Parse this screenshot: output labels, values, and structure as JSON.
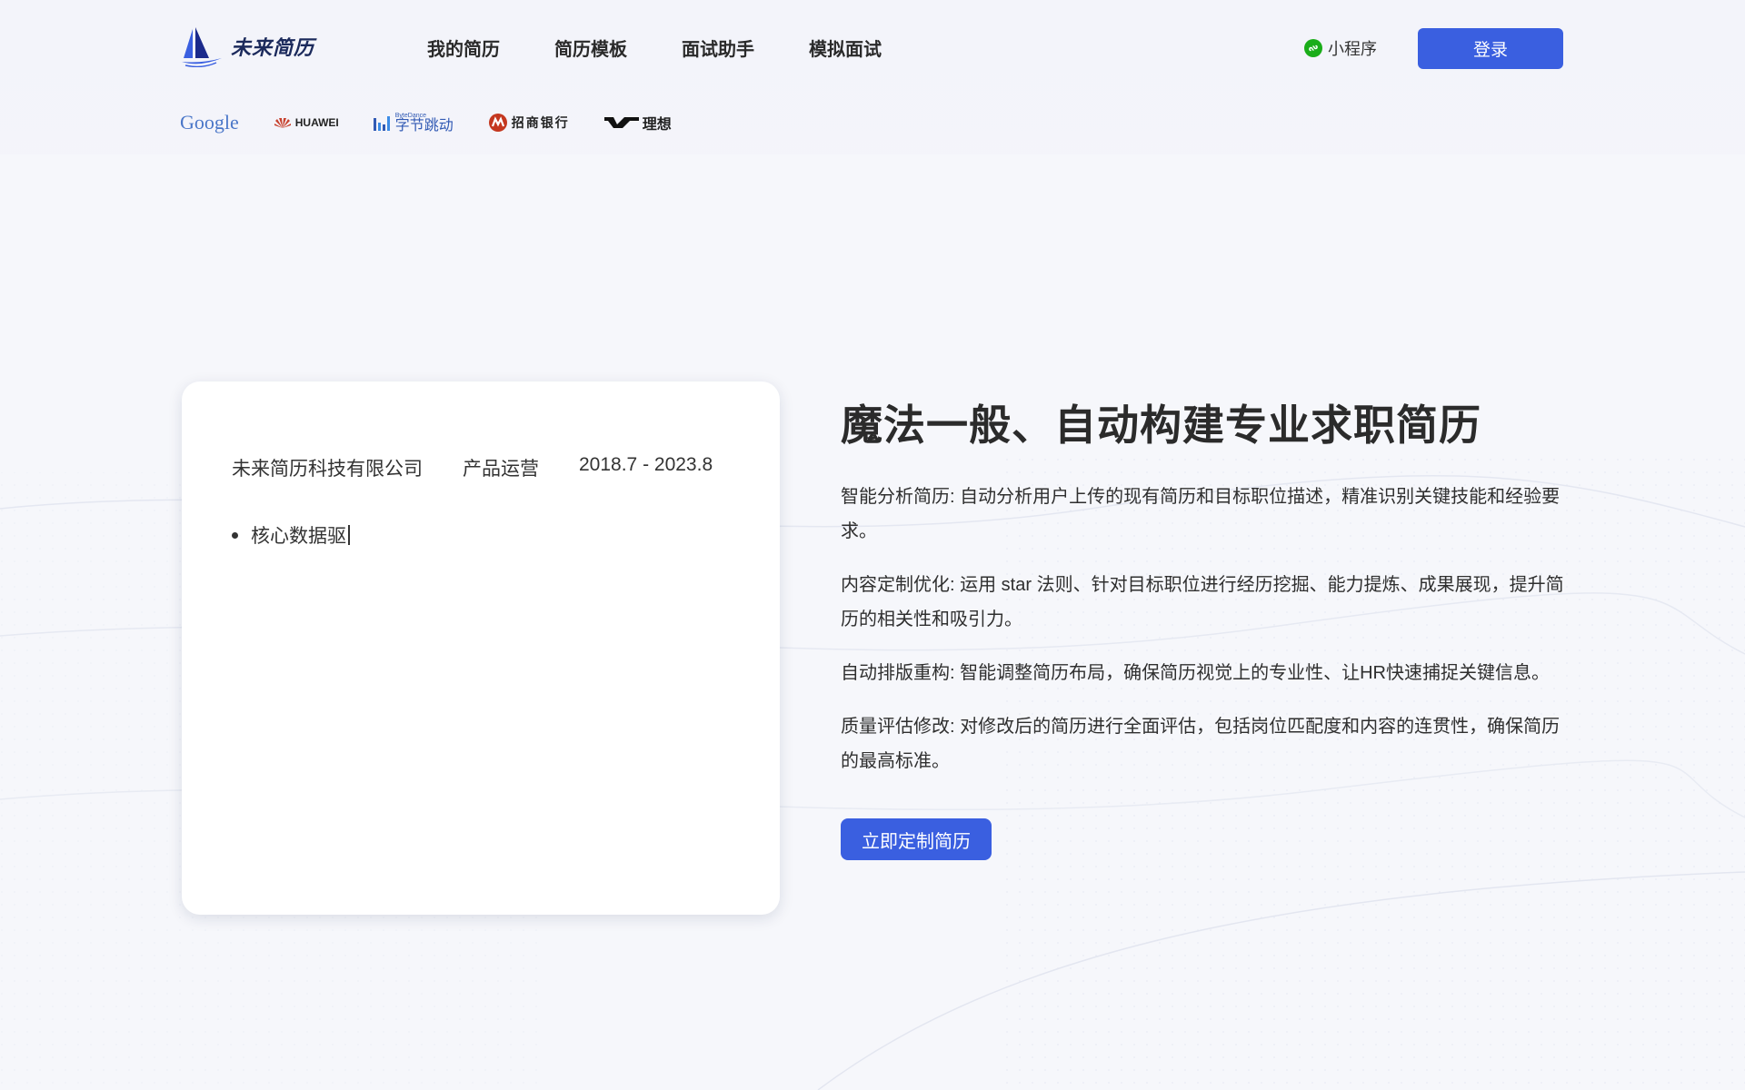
{
  "header": {
    "logo_text": "未来简历",
    "nav": [
      "我的简历",
      "简历模板",
      "面试助手",
      "模拟面试"
    ],
    "mini_program": "小程序",
    "login": "登录"
  },
  "partners": {
    "google": "Google",
    "huawei": "HUAWEI",
    "bytedance": "字节跳动",
    "bytedance_small": "ByteDance",
    "cmb": "招商银行",
    "lixiang": "理想"
  },
  "card": {
    "company": "未来简历科技有限公司",
    "role": "产品运营",
    "period": "2018.7 - 2023.8",
    "bullet_text": "核心数据驱"
  },
  "hero": {
    "headline": "魔法一般、自动构建专业求职简历",
    "features": [
      "智能分析简历: 自动分析用户上传的现有简历和目标职位描述，精准识别关键技能和经验要求。",
      "内容定制优化: 运用 star 法则、针对目标职位进行经历挖掘、能力提炼、成果展现，提升简历的相关性和吸引力。",
      "自动排版重构: 智能调整简历布局，确保简历视觉上的专业性、让HR快速捕捉关键信息。",
      "质量评估修改: 对修改后的简历进行全面评估，包括岗位匹配度和内容的连贯性，确保简历的最高标准。"
    ],
    "cta": "立即定制简历"
  },
  "colors": {
    "accent": "#3a5fe0",
    "background": "#f5f6fb",
    "mini_program_icon": "#1aad19"
  },
  "icons": {
    "logo": "sailboat-icon",
    "mini_program": "mini-program-icon"
  }
}
